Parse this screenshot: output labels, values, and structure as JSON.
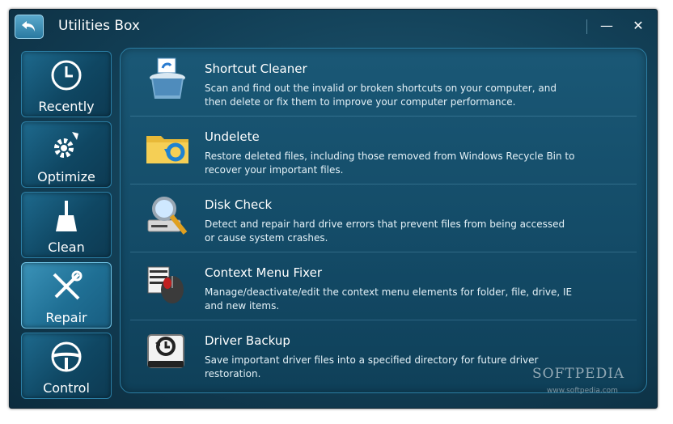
{
  "window": {
    "title": "Utilities Box",
    "minimize_label": "—",
    "close_label": "✕"
  },
  "sidebar": {
    "items": [
      {
        "label": "Recently",
        "icon": "clock-icon"
      },
      {
        "label": "Optimize",
        "icon": "gear-rocket-icon"
      },
      {
        "label": "Clean",
        "icon": "broom-icon"
      },
      {
        "label": "Repair",
        "icon": "wrench-screwdriver-icon",
        "active": true
      },
      {
        "label": "Control",
        "icon": "steering-wheel-icon"
      }
    ]
  },
  "tools": [
    {
      "title": "Shortcut Cleaner",
      "desc": "Scan and find out the invalid or broken shortcuts on your computer, and then delete or fix them to improve your computer performance.",
      "icon": "shortcut-bin-icon"
    },
    {
      "title": "Undelete",
      "desc": "Restore deleted files, including those removed from Windows Recycle Bin to recover your important files.",
      "icon": "folder-restore-icon"
    },
    {
      "title": "Disk Check",
      "desc": "Detect and repair hard drive errors that prevent files from being accessed or cause system crashes.",
      "icon": "disk-magnifier-icon"
    },
    {
      "title": "Context Menu Fixer",
      "desc": "Manage/deactivate/edit the context menu elements for folder, file, drive, IE and new items.",
      "icon": "mouse-menu-icon"
    },
    {
      "title": "Driver Backup",
      "desc": "Save important driver files into a specified directory for future driver restoration.",
      "icon": "drive-backup-icon"
    }
  ],
  "watermark": {
    "brand": "SOFTPEDIA",
    "url": "www.softpedia.com"
  },
  "colors": {
    "accent": "#2b7fa6",
    "background": "#123f56",
    "text": "#ffffff"
  }
}
